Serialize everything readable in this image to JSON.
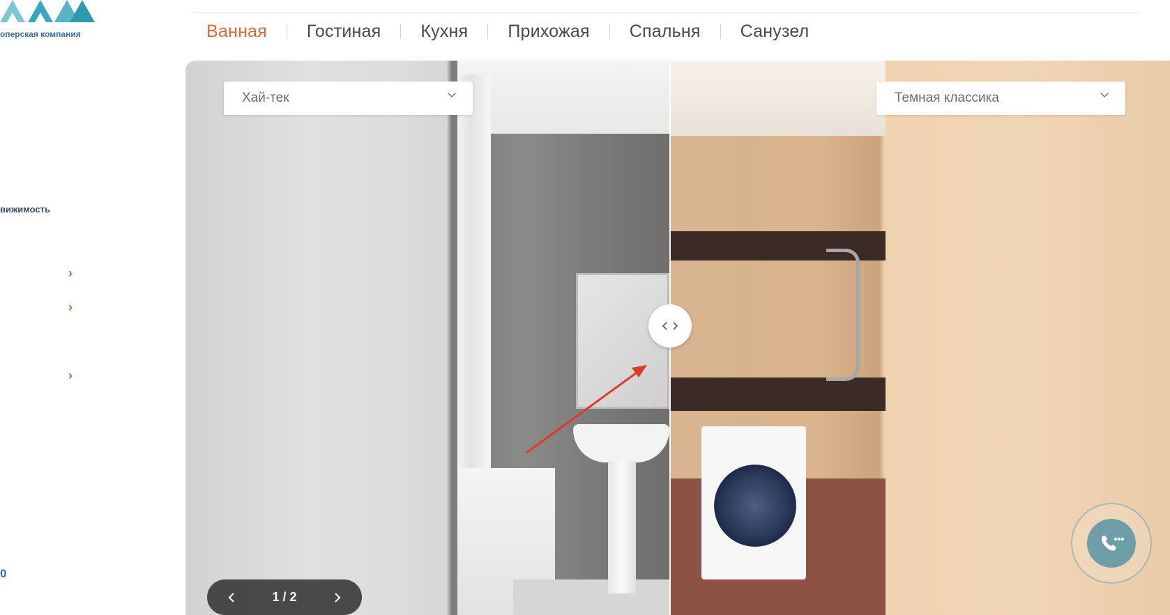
{
  "sidebar": {
    "logo_text": "оперская компания",
    "link_realty": "вижимость",
    "number_text": "0"
  },
  "tabs": [
    {
      "label": "Ванная",
      "active": true
    },
    {
      "label": "Гостиная",
      "active": false
    },
    {
      "label": "Кухня",
      "active": false
    },
    {
      "label": "Прихожая",
      "active": false
    },
    {
      "label": "Спальня",
      "active": false
    },
    {
      "label": "Санузел",
      "active": false
    }
  ],
  "viewer": {
    "left_style": "Хай-тек",
    "right_style": "Темная классика",
    "pager_text": "1 / 2"
  },
  "colors": {
    "accent": "#e0673a",
    "tab_text": "#4a4a4a",
    "call_button": "#6e9fa8",
    "annotation_arrow": "#e0392b"
  },
  "icons": [
    "logo-mark-icon",
    "chevron-right-icon",
    "chevron-down-icon",
    "compare-arrows-icon",
    "arrow-left-icon",
    "arrow-right-icon",
    "phone-icon"
  ]
}
